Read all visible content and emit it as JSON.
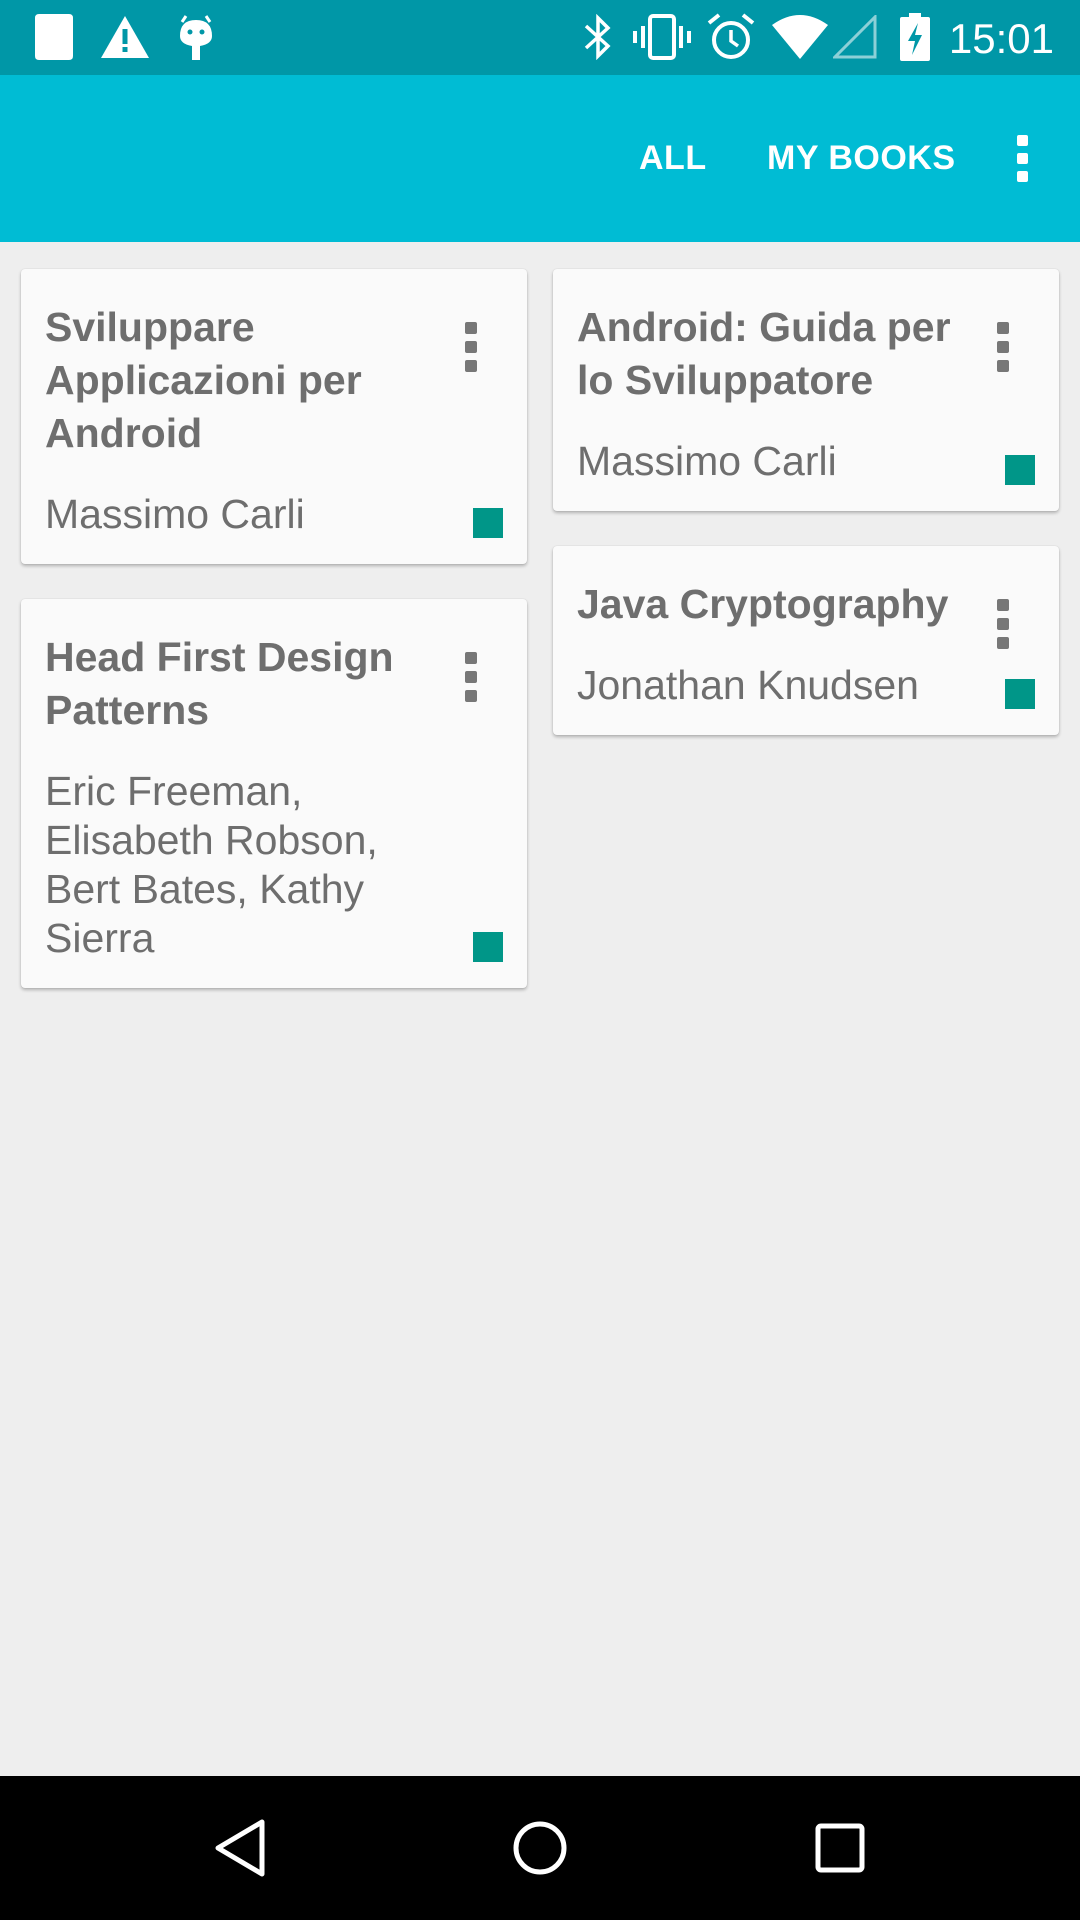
{
  "status_bar": {
    "time": "15:01",
    "icons": [
      "sd-card-icon",
      "warning-icon",
      "android-debug-icon",
      "bluetooth-icon",
      "vibrate-icon",
      "alarm-icon",
      "wifi-icon",
      "signal-icon",
      "battery-charging-icon"
    ]
  },
  "app_bar": {
    "tabs": [
      {
        "label": "ALL"
      },
      {
        "label": "MY BOOKS"
      }
    ],
    "overflow_icon": "more-vert-icon"
  },
  "books": [
    {
      "title": "Sviluppare Applicazioni per Android",
      "author": "Massimo Carli"
    },
    {
      "title": "Android: Guida per lo Sviluppatore",
      "author": "Massimo Carli"
    },
    {
      "title": "Head First Design Patterns",
      "author": "Eric Freeman, Elisabeth Robson, Bert Bates, Kathy Sierra"
    },
    {
      "title": "Java Cryptography",
      "author": "Jonathan Knudsen"
    }
  ],
  "colors": {
    "status_bar": "#0097a7",
    "app_bar": "#00bcd4",
    "accent_square": "#009688",
    "background": "#eeeeee",
    "card": "#fafafa"
  },
  "nav_bar": {
    "buttons": [
      "back-icon",
      "home-icon",
      "recents-icon"
    ]
  }
}
